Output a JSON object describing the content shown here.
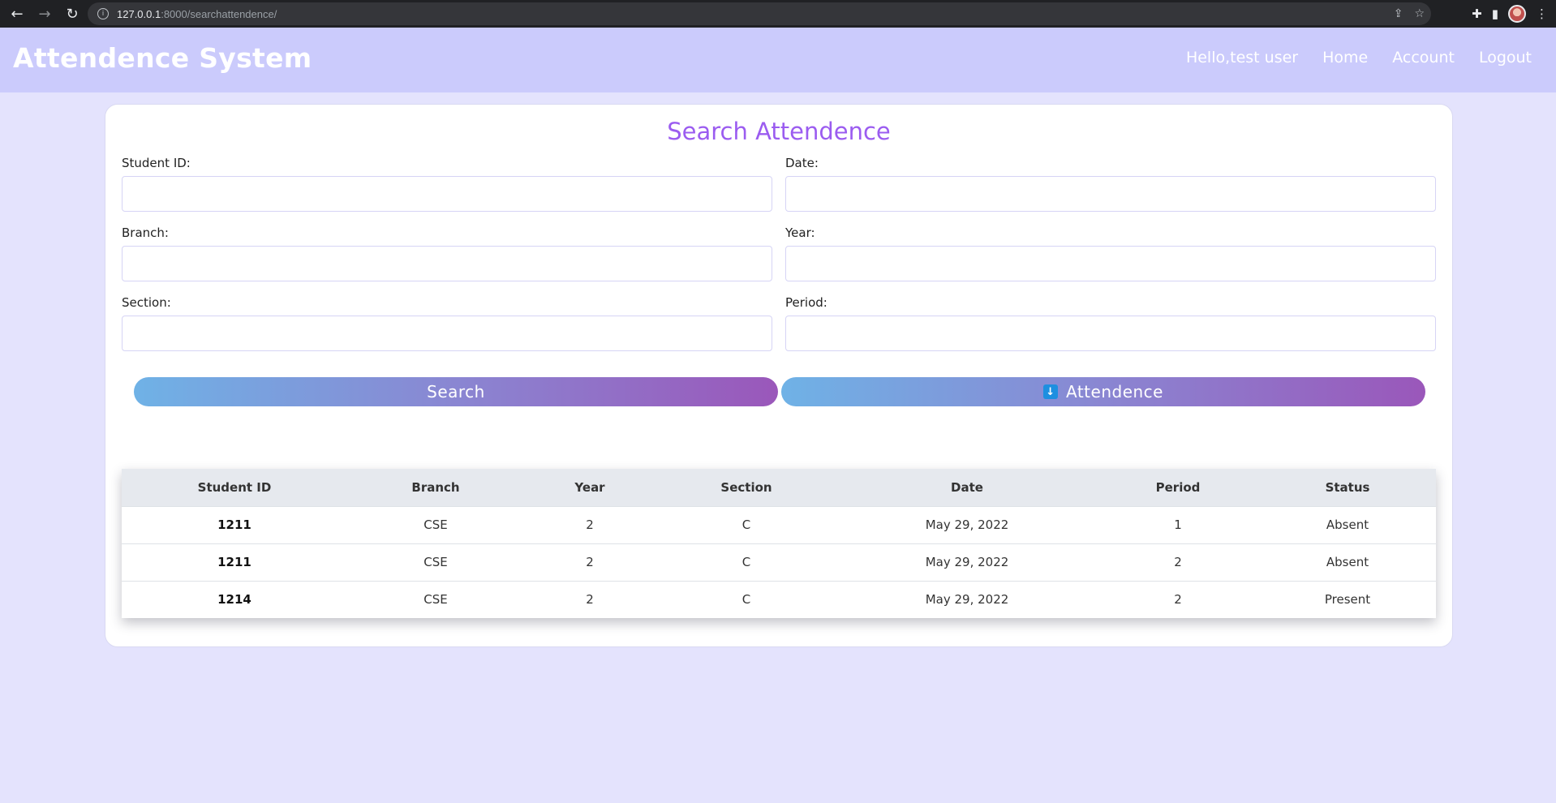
{
  "browser": {
    "url_host": "127.0.0.1",
    "url_path": ":8000/searchattendence/"
  },
  "header": {
    "brand": "Attendence System",
    "nav": {
      "greeting": "Hello,test user",
      "home": "Home",
      "account": "Account",
      "logout": "Logout"
    }
  },
  "form": {
    "title": "Search Attendence",
    "student_id_label": "Student ID:",
    "date_label": "Date:",
    "branch_label": "Branch:",
    "year_label": "Year:",
    "section_label": "Section:",
    "period_label": "Period:",
    "student_id_value": "",
    "date_value": "",
    "branch_value": "",
    "year_value": "",
    "section_value": "",
    "period_value": "",
    "search_button": "Search",
    "download_button": "Attendence"
  },
  "table": {
    "headers": [
      "Student ID",
      "Branch",
      "Year",
      "Section",
      "Date",
      "Period",
      "Status"
    ],
    "rows": [
      [
        "1211",
        "CSE",
        "2",
        "C",
        "May 29, 2022",
        "1",
        "Absent"
      ],
      [
        "1211",
        "CSE",
        "2",
        "C",
        "May 29, 2022",
        "2",
        "Absent"
      ],
      [
        "1214",
        "CSE",
        "2",
        "C",
        "May 29, 2022",
        "2",
        "Present"
      ]
    ]
  },
  "colors": {
    "page_bg": "#e4e3fd",
    "header_bg": "#cbcbfc",
    "title_purple": "#9b5cf0",
    "button_gradient_start": "#6fb2e6",
    "button_gradient_end": "#9a57ba"
  }
}
